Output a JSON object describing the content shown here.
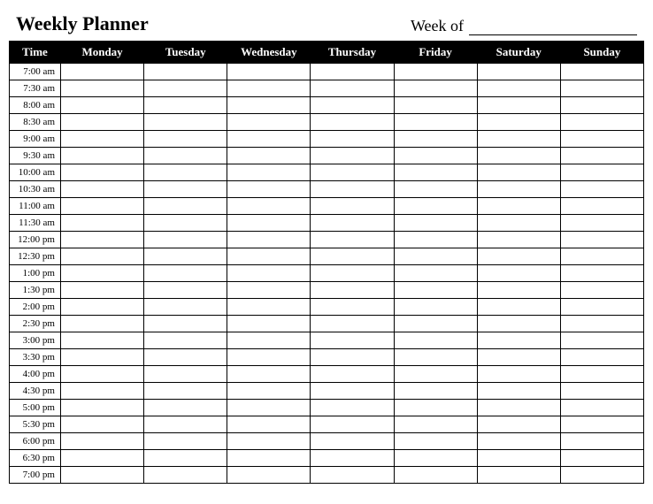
{
  "title": "Weekly Planner",
  "weekof_label": "Week of",
  "columns": [
    "Time",
    "Monday",
    "Tuesday",
    "Wednesday",
    "Thursday",
    "Friday",
    "Saturday",
    "Sunday"
  ],
  "times": [
    "7:00 am",
    "7:30 am",
    "8:00 am",
    "8:30 am",
    "9:00 am",
    "9:30 am",
    "10:00 am",
    "10:30 am",
    "11:00 am",
    "11:30 am",
    "12:00 pm",
    "12:30 pm",
    "1:00 pm",
    "1:30 pm",
    "2:00 pm",
    "2:30 pm",
    "3:00 pm",
    "3:30 pm",
    "4:00 pm",
    "4:30 pm",
    "5:00 pm",
    "5:30 pm",
    "6:00 pm",
    "6:30 pm",
    "7:00 pm"
  ]
}
